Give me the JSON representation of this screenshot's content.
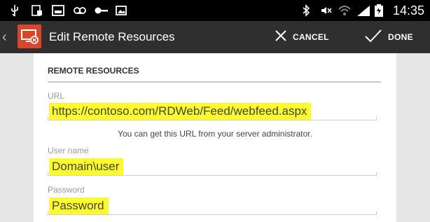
{
  "status_bar": {
    "time": "14:35",
    "icons": [
      "usb-icon",
      "notification-icon",
      "image-icon",
      "voicemail-icon",
      "key-icon",
      "photo-icon",
      "bluetooth-icon",
      "mute-icon",
      "wifi-icon",
      "signal-icon",
      "battery-icon"
    ]
  },
  "action_bar": {
    "back": "‹",
    "title": "Edit Remote Resources",
    "cancel_label": "CANCEL",
    "done_label": "DONE",
    "accent_color": "#d9472b"
  },
  "form": {
    "section_title": "REMOTE RESOURCES",
    "url_label": "URL",
    "url_value": "https://contoso.com/RDWeb/Feed/webfeed.aspx",
    "url_hint": "You can get this URL from your server administrator.",
    "username_label": "User name",
    "username_value": "Domain\\user",
    "password_label": "Password",
    "password_value": "Password",
    "highlight_color": "#fdfb2c"
  }
}
